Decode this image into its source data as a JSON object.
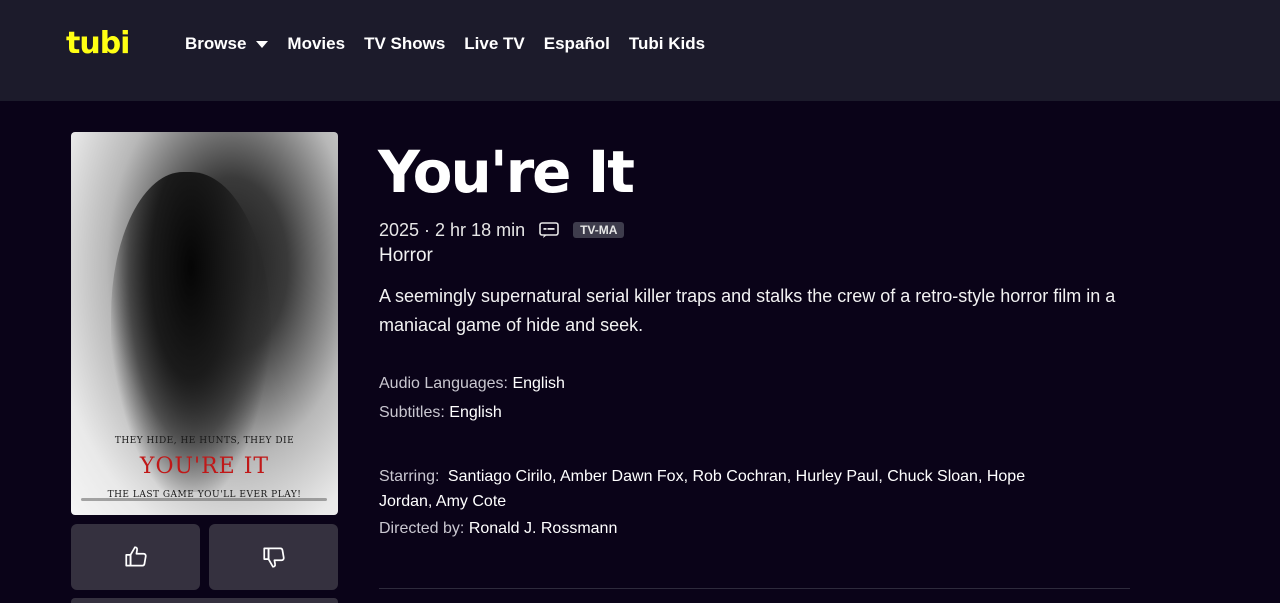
{
  "brand": {
    "logo_text": "tubi",
    "accent": "#ffff13",
    "background": "#0a0318",
    "header_bg": "#1c1b2b"
  },
  "nav": {
    "items": [
      {
        "label": "Browse",
        "has_dropdown": true
      },
      {
        "label": "Movies"
      },
      {
        "label": "TV Shows"
      },
      {
        "label": "Live TV"
      },
      {
        "label": "Español"
      },
      {
        "label": "Tubi Kids"
      }
    ]
  },
  "poster": {
    "tagline_top": "THEY HIDE, HE HUNTS, THEY DIE",
    "title": "YOU'RE IT",
    "tagline_bottom": "THE LAST GAME YOU'LL EVER PLAY!"
  },
  "movie": {
    "title": "You're It",
    "year_duration": "2025 · 2 hr 18 min",
    "cc_icon": "closed-captions-icon",
    "rating": "TV-MA",
    "genre": "Horror",
    "description": "A seemingly supernatural serial killer traps and stalks the crew of a retro-style horror film in a maniacal game of hide and seek.",
    "audio_label": "Audio Languages:",
    "audio_value": "English",
    "subtitles_label": "Subtitles:",
    "subtitles_value": "English",
    "starring_label": "Starring:",
    "starring_value": "Santiago Cirilo, Amber Dawn Fox, Rob Cochran, Hurley Paul, Chuck Sloan, Hope Jordan, Amy Cote",
    "directed_label": "Directed by:",
    "directed_value": "Ronald J. Rossmann"
  },
  "actions": {
    "like_icon": "thumbs-up-icon",
    "dislike_icon": "thumbs-down-icon"
  }
}
